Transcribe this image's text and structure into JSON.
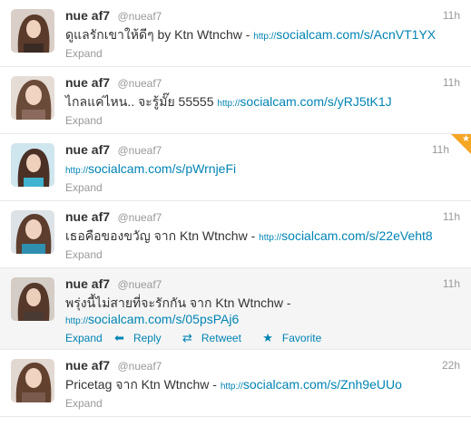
{
  "colors": {
    "link": "#0084b4",
    "muted": "#999999",
    "text": "#333333",
    "favorite_corner": "#f5a623"
  },
  "tweets": [
    {
      "name": "nue af7",
      "handle": "@nueaf7",
      "time": "11h",
      "text_before": "ดูแลรักเขาให้ดีๆ by Ktn Wtnchw - ",
      "link_prefix": "http://",
      "link_main": "socialcam.com/s/AcnVT1YX",
      "expand": "Expand"
    },
    {
      "name": "nue af7",
      "handle": "@nueaf7",
      "time": "11h",
      "text_before": "ไกลแค่ไหน.. จะรู้มั๊ย 55555 ",
      "link_prefix": "http://",
      "link_main": "socialcam.com/s/yRJ5tK1J",
      "expand": "Expand"
    },
    {
      "name": "nue af7",
      "handle": "@nueaf7",
      "time": "11h",
      "text_before": "",
      "link_prefix": "http://",
      "link_main": "socialcam.com/s/pWrnjeFi",
      "expand": "Expand",
      "favorited": true
    },
    {
      "name": "nue af7",
      "handle": "@nueaf7",
      "time": "11h",
      "text_before": "เธอคือของขวัญ จาก Ktn Wtnchw - ",
      "link_prefix": "http://",
      "link_main": "socialcam.com/s/22eVeht8",
      "expand": "Expand"
    },
    {
      "name": "nue af7",
      "handle": "@nueaf7",
      "time": "11h",
      "text_before": "พรุ่งนี้ไม่สายที่จะรักกัน จาก Ktn Wtnchw - ",
      "link_prefix": "http://",
      "link_main": "socialcam.com/s/05psPAj6",
      "expand": "Expand",
      "reply": "Reply",
      "retweet": "Retweet",
      "favorite": "Favorite"
    },
    {
      "name": "nue af7",
      "handle": "@nueaf7",
      "time": "22h",
      "text_before": "Pricetag จาก Ktn Wtnchw - ",
      "link_prefix": "http://",
      "link_main": "socialcam.com/s/Znh9eUUo",
      "expand": "Expand"
    }
  ]
}
